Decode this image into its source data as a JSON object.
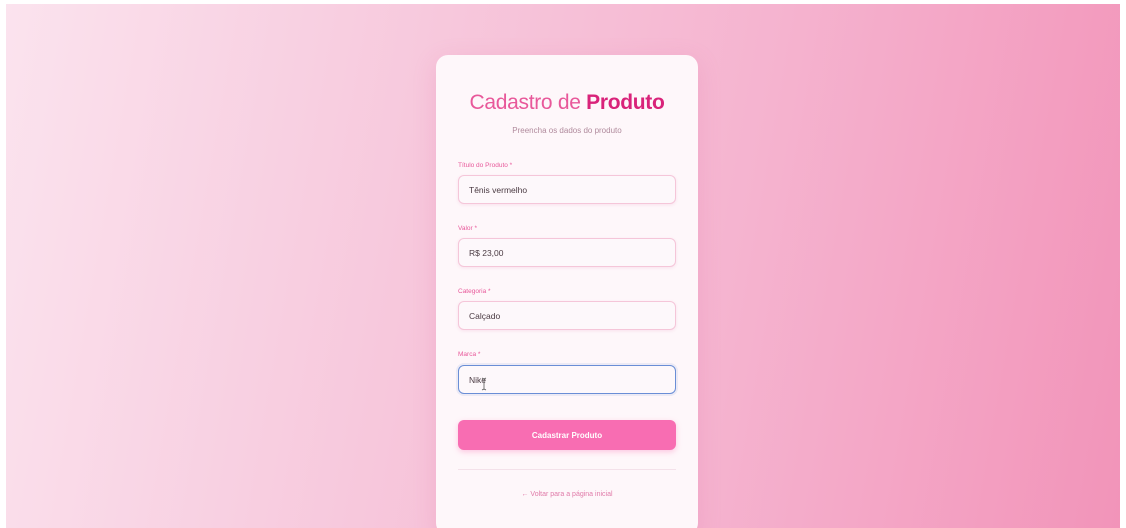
{
  "header": {
    "title_light": "Cadastro de ",
    "title_bold": "Produto",
    "subtitle": "Preencha os dados do produto"
  },
  "form": {
    "fields": [
      {
        "label": "Título do Produto *",
        "value": "Tênis vermelho"
      },
      {
        "label": "Valor *",
        "value": "R$ 23,00"
      },
      {
        "label": "Categoria *",
        "value": "Calçado"
      },
      {
        "label": "Marca *",
        "value": "Nike"
      }
    ],
    "submit_label": "Cadastrar Produto"
  },
  "footer": {
    "back_link": "← Voltar para a página inicial"
  },
  "icons": {
    "text_cursor": "text-cursor-icon"
  },
  "colors": {
    "accent": "#e8589a",
    "button": "#f86db2",
    "focus_border": "#6a8ed6"
  }
}
